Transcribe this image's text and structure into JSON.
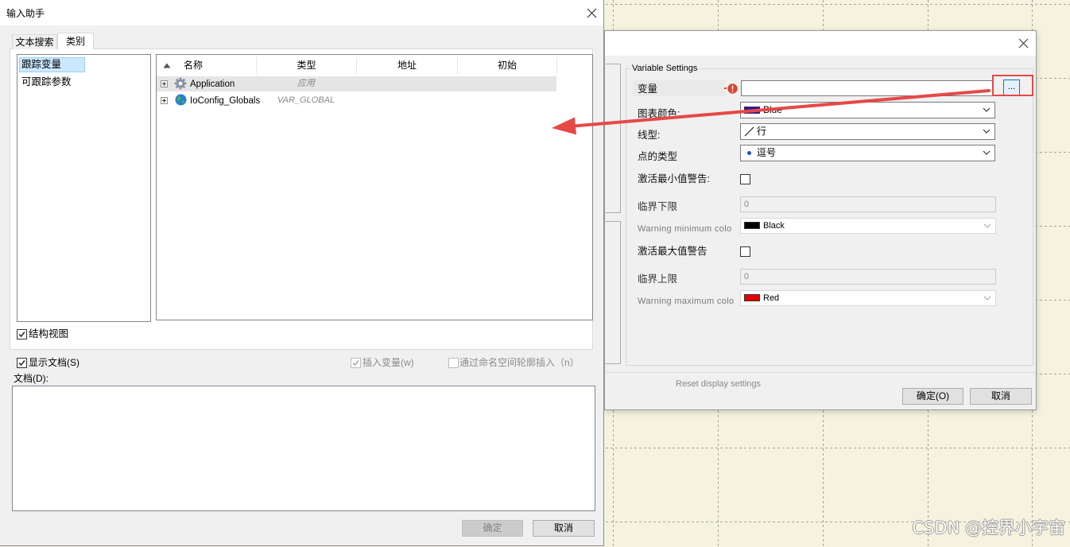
{
  "canvas": {
    "background": "#f5f3de",
    "grid_color": "#a3a3a3"
  },
  "input_assistant": {
    "title": "输入助手",
    "close_icon": "close-icon",
    "tabs": [
      {
        "label": "文本搜索",
        "selected": false
      },
      {
        "label": "类别",
        "selected": true
      }
    ],
    "categories": [
      {
        "label": "跟踪变量",
        "selected": true
      },
      {
        "label": "可跟踪参数",
        "selected": false
      }
    ],
    "table": {
      "sort_icon": "sort-ascending-icon",
      "columns": [
        "名称",
        "类型",
        "地址",
        "初始"
      ],
      "rows": [
        {
          "expander_icon": "plus-box-icon",
          "icon": "gear-icon",
          "name": "Application",
          "type": "应用",
          "highlighted": true
        },
        {
          "expander_icon": "plus-box-icon",
          "icon": "globe-icon",
          "name": "IoConfig_Globals",
          "type": "VAR_GLOBAL",
          "highlighted": false
        }
      ]
    },
    "structure_view": {
      "label": "结构视图",
      "checked": true
    },
    "show_documentation": {
      "label": "显示文档(S)",
      "checked": true
    },
    "insert_variable": {
      "label": "插入变量(w)",
      "checked": true,
      "enabled": false
    },
    "insert_with_namespace": {
      "label": "通过命名空间轮廓插入（n）",
      "checked": false,
      "enabled": false
    },
    "documentation": {
      "label": "文档(D):",
      "value": ""
    },
    "ok_button": {
      "label": "确定",
      "enabled": false
    },
    "cancel_button": {
      "label": "取消"
    }
  },
  "variable_settings": {
    "close_icon": "close-icon",
    "group_title": "Variable Settings",
    "variable": {
      "label": "变量",
      "value": "",
      "status_icon": "error-icon",
      "browse_label": "..."
    },
    "chart_color": {
      "label": "图表颜色:",
      "value": "Blue",
      "swatch": "#1e1ea6"
    },
    "line_type": {
      "label": "线型:",
      "value": "行",
      "icon": "line-icon"
    },
    "point_type": {
      "label": "点的类型",
      "value": "逗号",
      "icon": "dot-icon",
      "dot_color": "#1f4fd6"
    },
    "activate_min_warning": {
      "label": "激活最小值警告:",
      "checked": false
    },
    "lower_limit": {
      "label": "临界下限",
      "value": "0",
      "enabled": false
    },
    "warning_min_color": {
      "label": "Warning minimum colo",
      "value": "Black",
      "swatch": "#000000",
      "enabled": false
    },
    "activate_max_warning": {
      "label": "激活最大值警告",
      "checked": false
    },
    "upper_limit": {
      "label": "临界上限",
      "value": "0",
      "enabled": false
    },
    "warning_max_color": {
      "label": "Warning maximum colo",
      "value": "Red",
      "swatch": "#e60000",
      "enabled": false
    },
    "reset_label": "Reset display settings",
    "ok_button": {
      "label": "确定(O)"
    },
    "cancel_button": {
      "label": "取消"
    }
  },
  "annotation": {
    "color": "#e64848"
  },
  "watermark": "CSDN @控界小宇宙"
}
